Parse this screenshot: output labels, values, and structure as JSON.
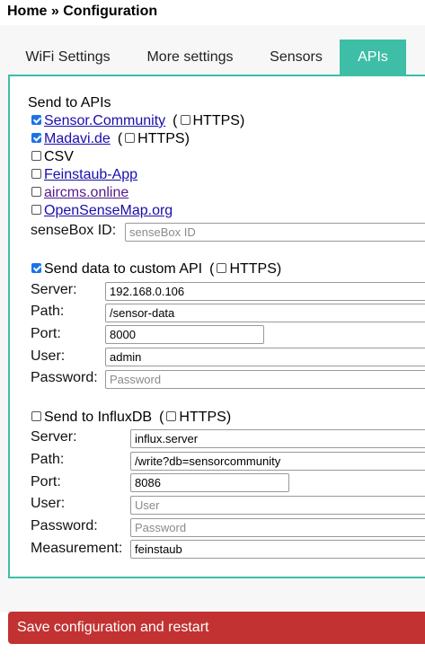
{
  "header": {
    "title": "Home » Configuration"
  },
  "tabs": [
    {
      "label": "WiFi Settings"
    },
    {
      "label": "More settings"
    },
    {
      "label": "Sensors"
    },
    {
      "label": "APIs"
    }
  ],
  "apis": {
    "heading": "Send to APIs",
    "sensor_community": {
      "label": "Sensor.Community",
      "checked": true,
      "https_label": "HTTPS",
      "https_checked": false
    },
    "madavi": {
      "label": "Madavi.de",
      "checked": true,
      "https_label": "HTTPS",
      "https_checked": false
    },
    "csv": {
      "label": "CSV",
      "checked": false
    },
    "feinstaub_app": {
      "label": "Feinstaub-App",
      "checked": false
    },
    "aircms": {
      "label": "aircms.online",
      "checked": false
    },
    "opensensemap": {
      "label": "OpenSenseMap.org",
      "checked": false
    },
    "sensebox": {
      "label": "senseBox ID:",
      "placeholder": "senseBox ID"
    }
  },
  "custom_api": {
    "label": "Send data to custom API",
    "checked": true,
    "https_label": "HTTPS",
    "https_checked": false,
    "server": {
      "label": "Server:",
      "value": "192.168.0.106"
    },
    "path": {
      "label": "Path:",
      "value": "/sensor-data"
    },
    "port": {
      "label": "Port:",
      "value": "8000"
    },
    "user": {
      "label": "User:",
      "value": "admin"
    },
    "password": {
      "label": "Password:",
      "placeholder": "Password"
    }
  },
  "influx": {
    "label": "Send to InfluxDB",
    "checked": false,
    "https_label": "HTTPS",
    "https_checked": false,
    "server": {
      "label": "Server:",
      "value": "influx.server"
    },
    "path": {
      "label": "Path:",
      "value": "/write?db=sensorcommunity"
    },
    "port": {
      "label": "Port:",
      "value": "8086"
    },
    "user": {
      "label": "User:",
      "placeholder": "User"
    },
    "password": {
      "label": "Password:",
      "placeholder": "Password"
    },
    "measurement": {
      "label": "Measurement:",
      "value": "feinstaub"
    }
  },
  "save_button": {
    "label": "Save configuration and restart"
  },
  "colors": {
    "accent": "#3ebea6",
    "save": "#c23232",
    "link": "#1a0dab",
    "checkbox": "#1a73e8"
  }
}
